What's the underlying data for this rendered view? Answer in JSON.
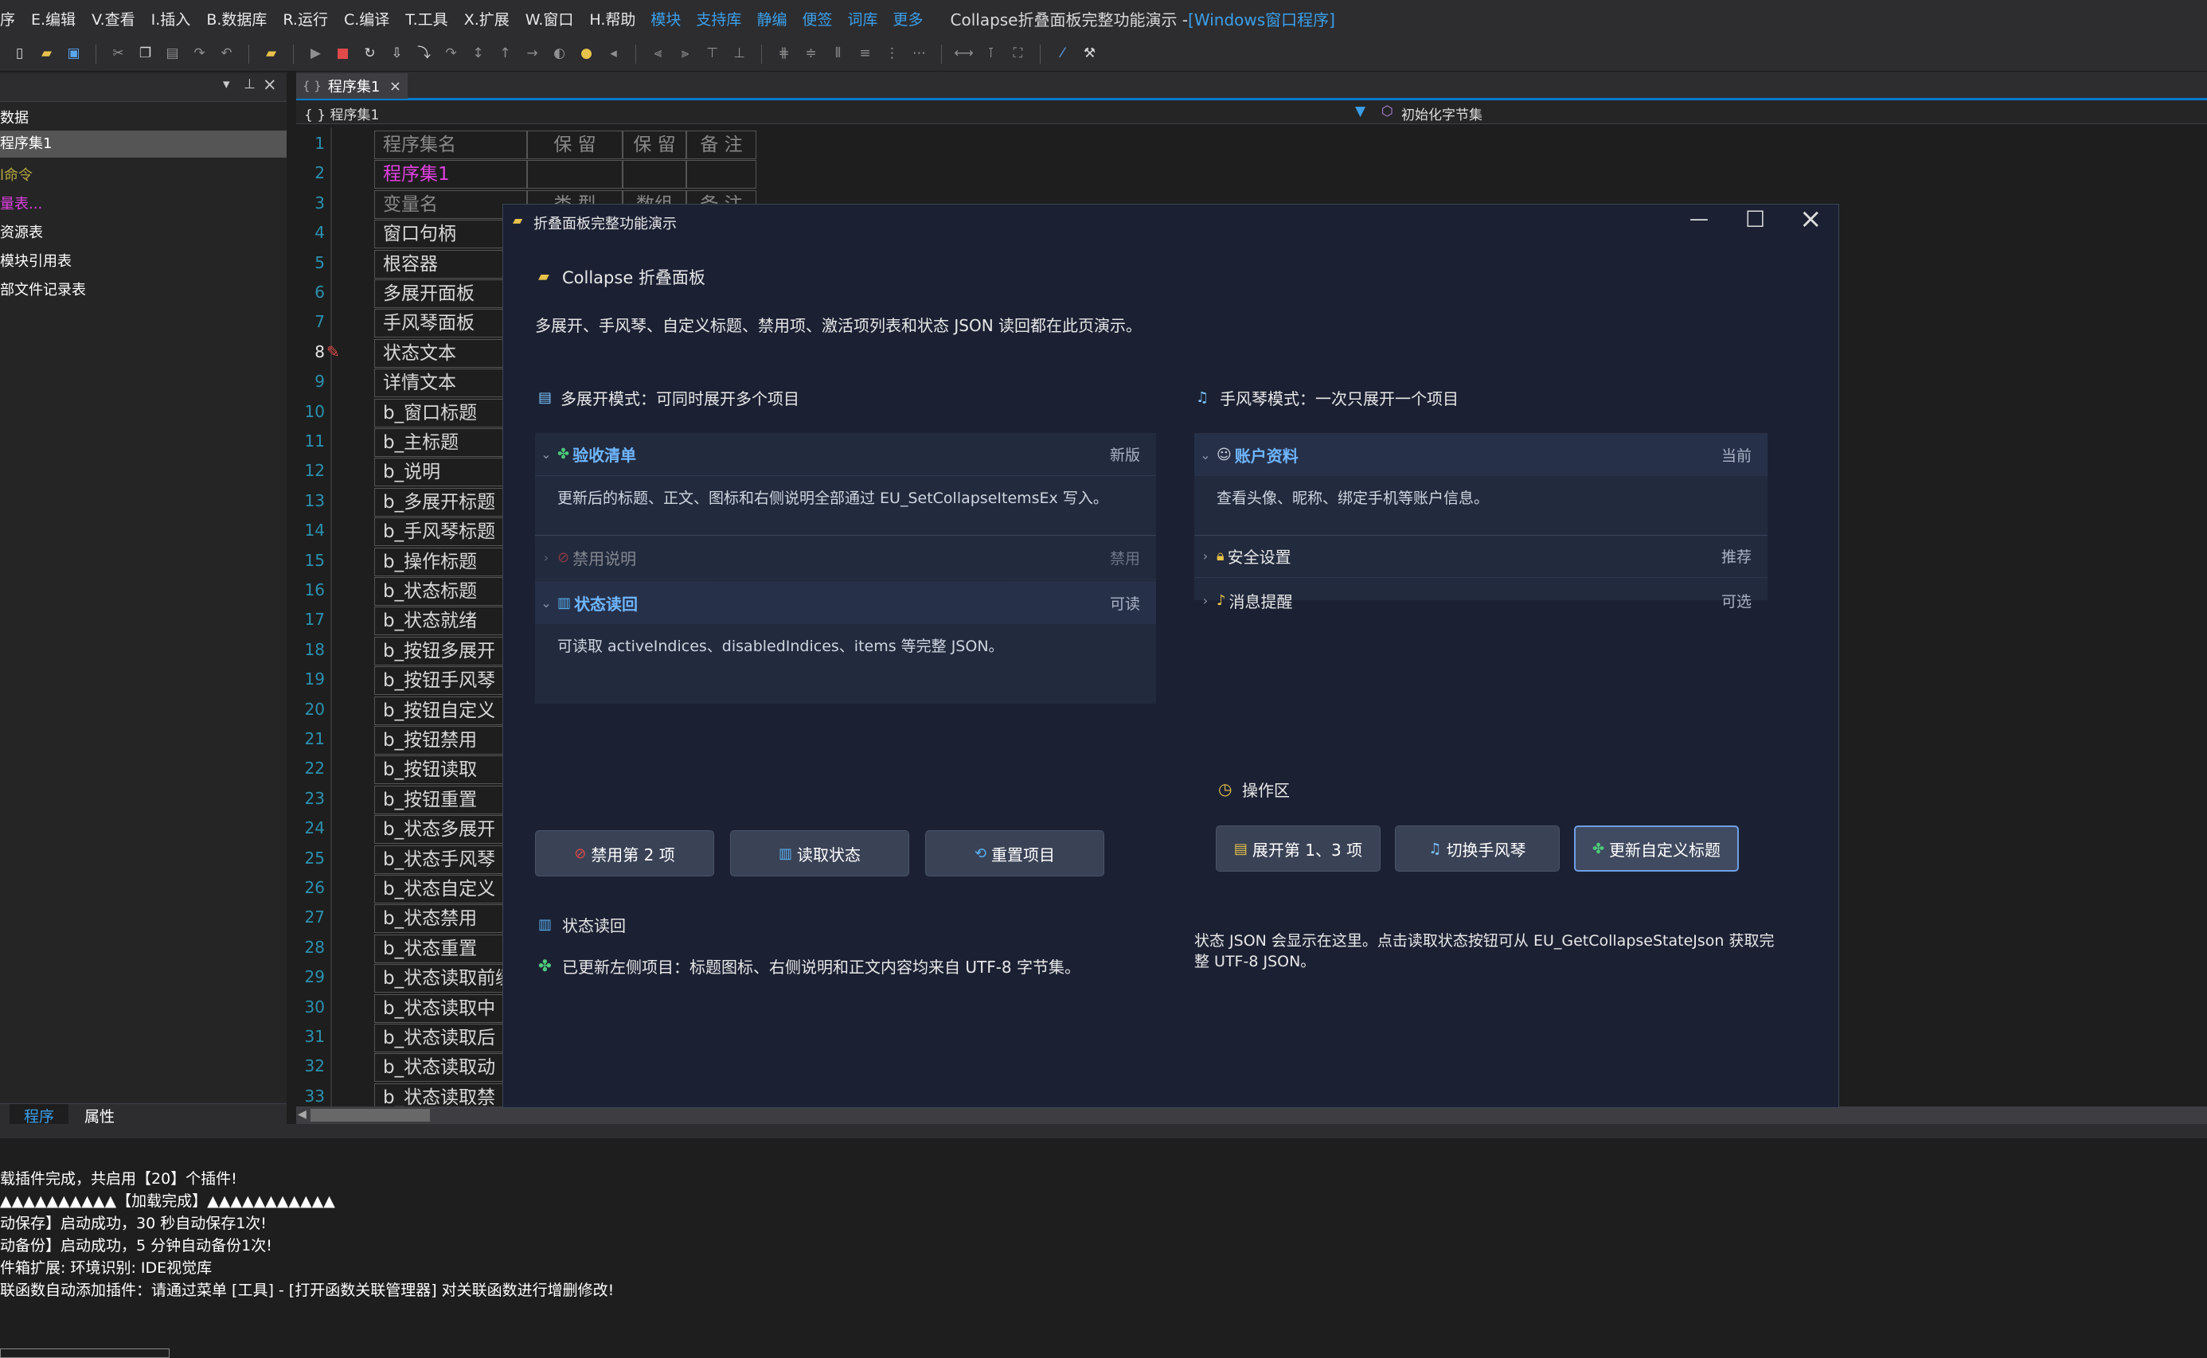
{
  "menubar": {
    "items": [
      "序",
      "E.编辑",
      "V.查看",
      "I.插入",
      "B.数据库",
      "R.运行",
      "C.编译",
      "T.工具",
      "X.扩展",
      "W.窗口",
      "H.帮助"
    ],
    "extra": [
      "模块",
      "支持库",
      "静编",
      "便签",
      "词库",
      "更多"
    ],
    "title": "Collapse折叠面板完整功能演示 - ",
    "title_suffix": "[Windows窗口程序]"
  },
  "left_panel": {
    "items": [
      "数据",
      "程序集1",
      "l命令",
      "量表...",
      "资源表",
      "模块引用表",
      "部文件记录表"
    ],
    "tabs": [
      "程序",
      "属性"
    ]
  },
  "editor": {
    "tab_label": "程序集1",
    "nav_left": "{ } 程序集1",
    "nav_right": "初始化字节集",
    "header_row": [
      "程序集名",
      "保 留",
      "保 留",
      "备 注"
    ],
    "row2_name": "程序集1",
    "row3": [
      "变量名",
      "类 型",
      "数组",
      "备 注"
    ],
    "line_numbers": [
      "1",
      "2",
      "3",
      "4",
      "5",
      "6",
      "7",
      "8",
      "9",
      "10",
      "11",
      "12",
      "13",
      "14",
      "15",
      "16",
      "17",
      "18",
      "19",
      "20",
      "21",
      "22",
      "23",
      "24",
      "25",
      "26",
      "27",
      "28",
      "29",
      "30",
      "31",
      "32",
      "33"
    ],
    "variables": [
      "窗口句柄",
      "根容器",
      "多展开面板",
      "手风琴面板",
      "状态文本",
      "详情文本",
      "b_窗口标题",
      "b_主标题",
      "b_说明",
      "b_多展开标题",
      "b_手风琴标题",
      "b_操作标题",
      "b_状态标题",
      "b_状态就绪",
      "b_按钮多展开",
      "b_按钮手风琴",
      "b_按钮自定义",
      "b_按钮禁用",
      "b_按钮读取",
      "b_按钮重置",
      "b_状态多展开",
      "b_状态手风琴",
      "b_状态自定义",
      "b_状态禁用",
      "b_状态重置",
      "b_状态读取前缀",
      "b_状态读取中",
      "b_状态读取后",
      "b_状态读取动",
      "b_状态读取禁"
    ]
  },
  "output": {
    "lines": [
      "载插件完成，共启用【20】个插件!",
      "▲▲▲▲▲▲▲▲▲▲【加载完成】▲▲▲▲▲▲▲▲▲▲▲",
      "动保存】启动成功，30 秒自动保存1次!",
      "动备份】启动成功，5 分钟自动备份1次!",
      "件箱扩展:   环境识别:   IDE视觉库",
      "联函数自动添加插件：请通过菜单 [工具] - [打开函数关联管理器] 对关联函数进行增删修改!"
    ]
  },
  "dialog": {
    "title": "折叠面板完整功能演示",
    "heading": "Collapse 折叠面板",
    "description": "多展开、手风琴、自定义标题、禁用项、激活项列表和状态 JSON 读回都在此页演示。",
    "multi": {
      "title": "多展开模式：可同时展开多个项目",
      "items": [
        {
          "label": "验收清单",
          "badge": "新版",
          "body": "更新后的标题、正文、图标和右侧说明全部通过 EU_SetCollapseItemsEx 写入。"
        },
        {
          "label": "禁用说明",
          "badge": "禁用"
        },
        {
          "label": "状态读回",
          "badge": "可读",
          "body": "可读取 activeIndices、disabledIndices、items 等完整 JSON。"
        }
      ]
    },
    "accordion": {
      "title": "手风琴模式：一次只展开一个项目",
      "items": [
        {
          "label": "账户资料",
          "badge": "当前",
          "body": "查看头像、昵称、绑定手机等账户信息。"
        },
        {
          "label": "安全设置",
          "badge": "推荐"
        },
        {
          "label": "消息提醒",
          "badge": "可选"
        }
      ]
    },
    "ops_title": "操作区",
    "buttons_left": [
      "禁用第 2 项",
      "读取状态",
      "重置项目"
    ],
    "buttons_right": [
      "展开第 1、3 项",
      "切换手风琴",
      "更新自定义标题"
    ],
    "status_title": "状态读回",
    "status_text": "已更新左侧项目：标题图标、右侧说明和正文内容均来自 UTF-8 字节集。",
    "json_text": "状态 JSON 会显示在这里。点击读取状态按钮可从 EU_GetCollapseStateJson 获取完整 UTF-8 JSON。"
  },
  "colors": {
    "accent": "#3c9fe8",
    "dialog_bg": "#1b2133",
    "panel_bg": "#222a3d",
    "magenta": "#e040e0"
  }
}
